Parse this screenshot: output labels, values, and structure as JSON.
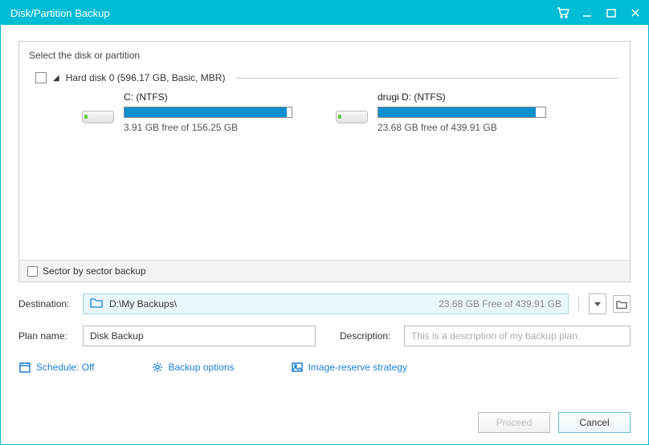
{
  "window": {
    "title": "Disk/Partition Backup"
  },
  "panel": {
    "header": "Select the disk or partition",
    "disk_label": "Hard disk 0 (596.17 GB, Basic, MBR)",
    "sector_backup_label": "Sector by sector backup",
    "partitions": [
      {
        "name": "C: (NTFS)",
        "free_text": "3.91 GB free of 156.25 GB",
        "fill_pct": 97
      },
      {
        "name": "drugi D: (NTFS)",
        "free_text": "23.68 GB free of 439.91 GB",
        "fill_pct": 94
      }
    ]
  },
  "destination": {
    "label": "Destination:",
    "path": "D:\\My Backups\\",
    "free_text": "23.68 GB Free of 439.91 GB"
  },
  "plan": {
    "label": "Plan name:",
    "value": "Disk Backup",
    "desc_label": "Description:",
    "desc_placeholder": "This is a description of my backup plan."
  },
  "options": {
    "schedule": "Schedule: Off",
    "backup_options": "Backup options",
    "image_reserve": "Image-reserve strategy"
  },
  "buttons": {
    "proceed": "Proceed",
    "cancel": "Cancel"
  }
}
